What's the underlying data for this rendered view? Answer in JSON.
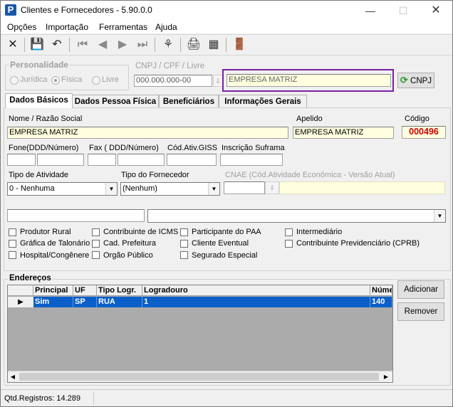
{
  "window": {
    "title": "Clientes e Fornecedores - 5.90.0.0"
  },
  "menu": [
    "Opções",
    "Importação",
    "Ferramentas",
    "Ajuda"
  ],
  "personalidade": {
    "legend": "Personalidade",
    "options": [
      "Jurídica",
      "Física",
      "Livre"
    ],
    "selected": "Física"
  },
  "cnpj": {
    "label": "CNPJ / CPF / Livre",
    "value": "000.000.000-00",
    "company": "EMPRESA MATRIZ",
    "button": "CNPJ"
  },
  "tabs": [
    "Dados Básicos",
    "Dados Pessoa Física",
    "Beneficiários",
    "Informações Gerais"
  ],
  "form": {
    "nome_label": "Nome / Razão Social",
    "nome_value": "EMPRESA MATRIZ",
    "apelido_label": "Apelido",
    "apelido_value": "EMPRESA MATRIZ",
    "codigo_label": "Código",
    "codigo_value": "000496",
    "fone_label": "Fone(DDD/Número)",
    "fax_label": "Fax ( DDD/Número)",
    "giss_label": "Cód.Ativ.GISS",
    "suframa_label": "Inscrição Suframa",
    "tipo_atividade_label": "Tipo de Atividade",
    "tipo_atividade_value": "0 - Nenhuma",
    "tipo_fornecedor_label": "Tipo do Fornecedor",
    "tipo_fornecedor_value": "(Nenhum)",
    "cnae_label": "CNAE (Cód.Atividade Econômica - Versão Atual)"
  },
  "checkboxes": {
    "col1": [
      "Produtor Rural",
      "Gráfica de Talonário",
      "Hospital/Congênere"
    ],
    "col2": [
      "Contribuinte de ICMS",
      "Cad. Prefeitura",
      "Orgão Público"
    ],
    "col3": [
      "Participante do PAA",
      "Cliente Eventual",
      "Segurado Especial"
    ],
    "col4": [
      "Intermediário",
      "Contribuinte Previdenciário (CPRB)"
    ]
  },
  "enderecos": {
    "legend": "Endereços",
    "columns": [
      "Principal",
      "UF",
      "Tipo Logr.",
      "Logradouro",
      "Núme"
    ],
    "rows": [
      [
        "Sim",
        "SP",
        "RUA",
        "1",
        "140"
      ]
    ],
    "add_button": "Adicionar",
    "remove_button": "Remover"
  },
  "status": {
    "registros": "Qtd.Registros: 14.289"
  },
  "colors": {
    "highlight_border": "#7b1fa2",
    "selection": "#0a5fc8",
    "codigo_red": "#cc0000",
    "yellow_field": "#ffffdf"
  }
}
